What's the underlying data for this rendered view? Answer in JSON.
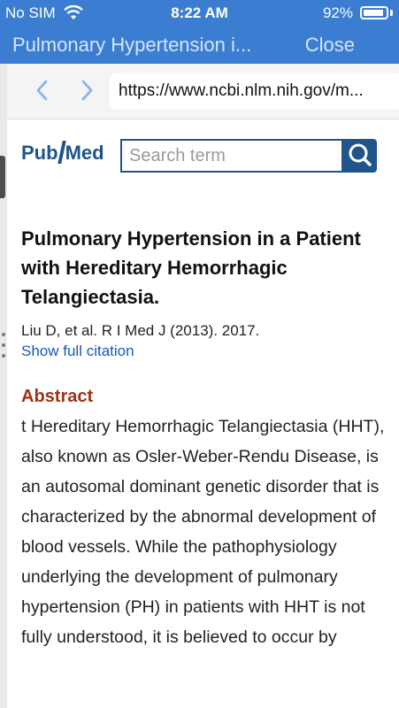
{
  "status_bar": {
    "carrier": "No SIM",
    "time": "8:22 AM",
    "battery": "92%",
    "battery_level": 0.92
  },
  "title_bar": {
    "title": "Pulmonary Hypertension i...",
    "close_label": "Close"
  },
  "browser": {
    "url": "https://www.ncbi.nlm.nih.gov/m..."
  },
  "pubmed": {
    "logo_pub": "Pub",
    "logo_med": "Med",
    "search_placeholder": "Search term"
  },
  "article": {
    "title": "Pulmonary Hypertension in a Patient with Hereditary Hemorrhagic Telangiectasia.",
    "citation": "Liu D, et al. R I Med J (2013). 2017.",
    "show_citation": "Show full citation",
    "abstract_heading": "Abstract",
    "abstract_text": "t Hereditary Hemorrhagic Telangiectasia (HHT), also known as Osler-Weber-Rendu Disease, is an autosomal dominant genetic disorder that is characterized by the abnormal development of blood vessels. While the pathophysiology underlying the development of pulmonary hypertension (PH) in patients with HHT is not fully understood, it is believed to occur by"
  },
  "colors": {
    "header_blue": "#3b7ed1",
    "pubmed_blue": "#20558a",
    "link_blue": "#1a57b6",
    "abstract_heading": "#9a3412"
  }
}
